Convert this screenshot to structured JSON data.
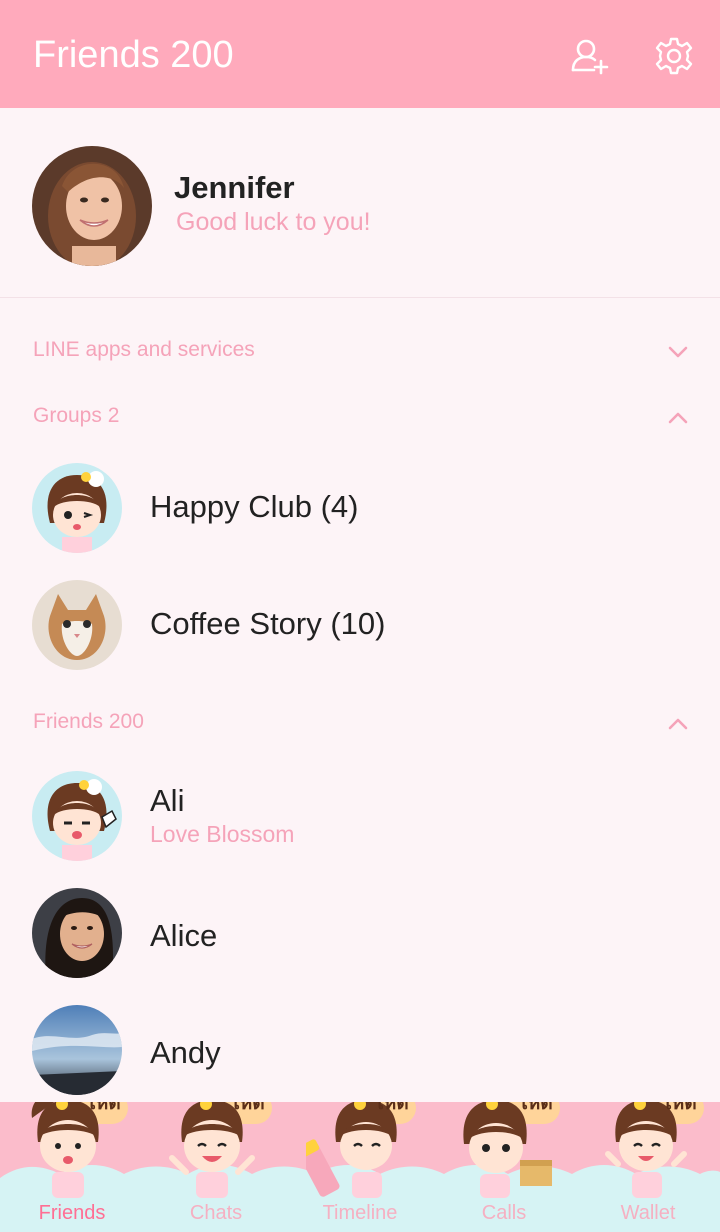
{
  "header": {
    "title": "Friends 200",
    "add_friend_icon": "add-friend-icon",
    "settings_icon": "gear-icon"
  },
  "profile": {
    "name": "Jennifer",
    "status": "Good luck to you!"
  },
  "sections": {
    "services": {
      "label": "LINE apps and services",
      "expanded": false
    },
    "groups": {
      "label": "Groups 2",
      "expanded": true
    },
    "friends": {
      "label": "Friends 200",
      "expanded": true
    }
  },
  "groups": [
    {
      "name": "Happy Club (4)"
    },
    {
      "name": "Coffee Story (10)"
    }
  ],
  "friends": [
    {
      "name": "Ali",
      "status": "Love Blossom"
    },
    {
      "name": "Alice",
      "status": ""
    },
    {
      "name": "Andy",
      "status": ""
    }
  ],
  "tabs": [
    {
      "label": "Friends",
      "active": true,
      "badge": "เห็ด"
    },
    {
      "label": "Chats",
      "active": false,
      "badge": "เห็ด"
    },
    {
      "label": "Timeline",
      "active": false,
      "badge": "เห็ด"
    },
    {
      "label": "Calls",
      "active": false,
      "badge": "เห็ด"
    },
    {
      "label": "Wallet",
      "active": false,
      "badge": "เห็ด"
    }
  ],
  "colors": {
    "header": "#ffaabc",
    "accent_text": "#f5a3b9",
    "active_tab": "#ff6f94",
    "background": "#fdf4f7"
  }
}
